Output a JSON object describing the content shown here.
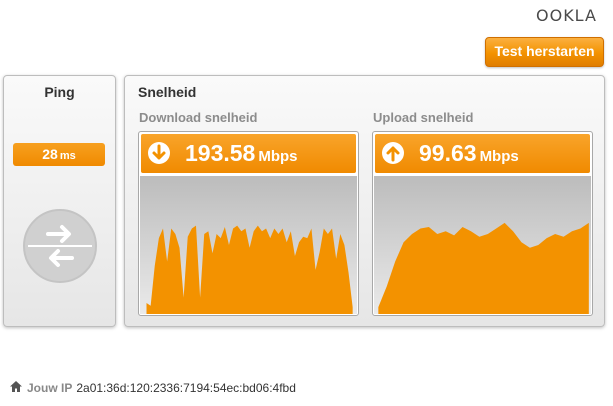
{
  "brand": {
    "logo_text": "OOKLA"
  },
  "toolbar": {
    "restart_label": "Test herstarten"
  },
  "ping": {
    "title": "Ping",
    "value": "28",
    "unit": "ms"
  },
  "speed": {
    "title": "Snelheid",
    "download": {
      "label": "Download snelheid",
      "value": "193.58",
      "unit": "Mbps",
      "graph": [
        0.08,
        0.06,
        0.35,
        0.55,
        0.62,
        0.38,
        0.62,
        0.58,
        0.48,
        0.12,
        0.56,
        0.62,
        0.64,
        0.12,
        0.58,
        0.6,
        0.44,
        0.58,
        0.55,
        0.63,
        0.5,
        0.62,
        0.64,
        0.6,
        0.62,
        0.48,
        0.6,
        0.64,
        0.6,
        0.62,
        0.55,
        0.62,
        0.58,
        0.62,
        0.52,
        0.6,
        0.42,
        0.52,
        0.56,
        0.55,
        0.62,
        0.32,
        0.45,
        0.62,
        0.58,
        0.62,
        0.4,
        0.58,
        0.5,
        0.3,
        0.05
      ]
    },
    "upload": {
      "label": "Upload snelheid",
      "value": "99.63",
      "unit": "Mbps",
      "graph": [
        0.05,
        0.2,
        0.38,
        0.52,
        0.58,
        0.62,
        0.63,
        0.58,
        0.6,
        0.57,
        0.63,
        0.6,
        0.56,
        0.58,
        0.62,
        0.66,
        0.6,
        0.52,
        0.48,
        0.5,
        0.55,
        0.58,
        0.56,
        0.6,
        0.62,
        0.66
      ]
    }
  },
  "footer": {
    "ip_label": "Jouw IP",
    "ip_value": "2a01:36d:120:2336:7194:54ec:bd06:4fbd"
  },
  "colors": {
    "accent": "#f39200",
    "panel_border": "#bdbdbd",
    "muted_label": "#8c8c8c"
  },
  "icons": [
    "home-icon",
    "download-arrow-icon",
    "upload-arrow-icon",
    "ping-arrows-icon"
  ]
}
